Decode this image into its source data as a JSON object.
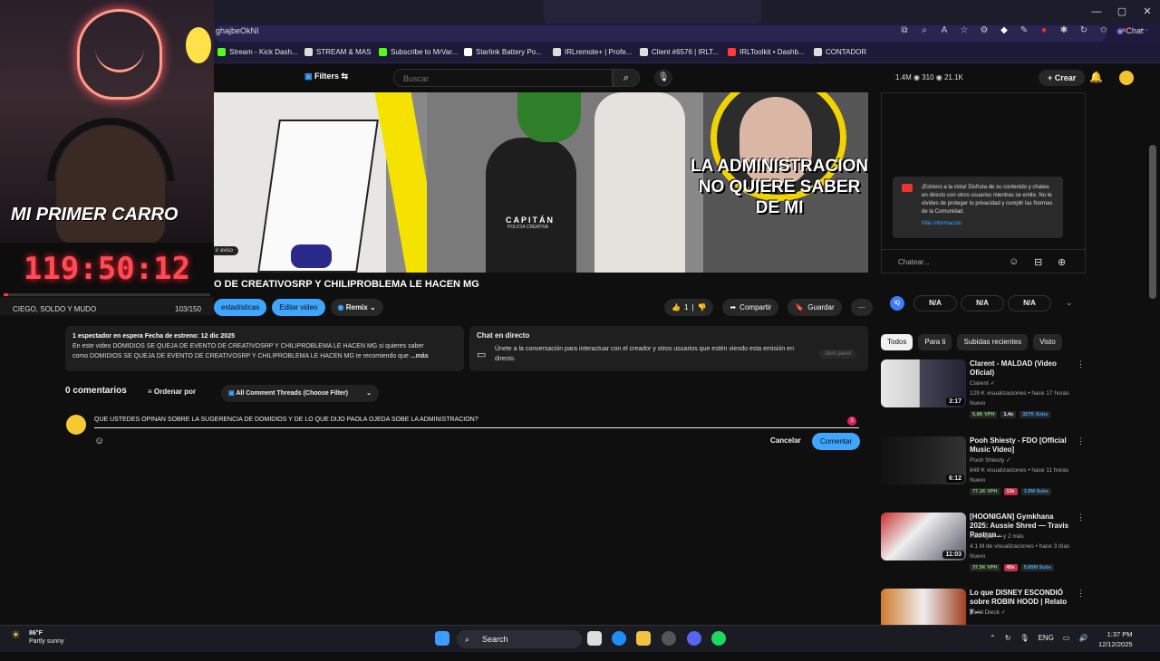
{
  "browser": {
    "url": "ghajbeOkNI",
    "chat_label": "Chat",
    "window_controls": [
      "—",
      "▢",
      "✕"
    ]
  },
  "bookmarks": [
    {
      "label": "Stream - Kick Dash...",
      "color": "#53fc18"
    },
    {
      "label": "STREAM & MAS",
      "color": "#dddddd"
    },
    {
      "label": "Subscribe to MrVar...",
      "color": "#53fc18"
    },
    {
      "label": "Starlink Battery Po...",
      "color": "#ffffff"
    },
    {
      "label": "IRLremote+ | Profe...",
      "color": "#dddddd"
    },
    {
      "label": "Client #6576 | IRLT...",
      "color": "#dddddd"
    },
    {
      "label": "IRLToolkit • Dashb...",
      "color": "#ff3b3b"
    },
    {
      "label": "CONTADOR",
      "color": "#dddddd"
    }
  ],
  "youtube": {
    "filters_label": "Filters",
    "search_placeholder": "Buscar",
    "stats": "1.4M  ◉ 310  ◉ 21.1K",
    "create_label": "Crear"
  },
  "webcam": {
    "overlay_text": "MI PRIMER CARRO",
    "timer": "119:50:12",
    "goal_label": "CIEGO, SOLDO Y MUDO",
    "goal_count": "103/150",
    "progress": 0.02
  },
  "video": {
    "overlay_title": "LA ADMINISTRACION NO QUIERE SABER DE MI",
    "capitan_text": "CAPITÁN",
    "policia_text": "POLICIA CREATIVA",
    "aviso_label": "ir aviso",
    "title": "O DE CREATIVOSRP Y CHILIPROBLEMA LE HACEN MG",
    "buttons": {
      "stats": "estadísticas",
      "edit": "Editar video",
      "remix": "Remix"
    },
    "actions": {
      "likes": "1",
      "share": "Compartir",
      "save": "Guardar"
    }
  },
  "description": {
    "meta": "1 espectador en espera  Fecha de estreno: 12 dic 2025",
    "line1": "En este video DOMIDIOS SE QUEJA DE EVENTO DE CREATIVOSRP Y CHILIPROBLEMA LE HACEN MG  si quieres saber",
    "line2": "como DOMIDIOS SE QUEJA DE EVENTO DE CREATIVOSRP Y CHILIPROBLEMA LE HACEN MG  te recomiendo que",
    "more": "...más"
  },
  "livechat_box": {
    "title": "Chat en directo",
    "text": "Únete a la conversación para interactuar con el creador y otros usuarios que estén viendo esta emisión en directo.",
    "button": "Abrir panel"
  },
  "comments": {
    "count_label": "0 comentarios",
    "sort_label": "Ordenar por",
    "filter_label": "All Comment Threads (Choose Filter)",
    "draft": "QUE USTEDES OPINAN SOBRE LA SUGERENCIA DE DOMIDIOS Y DE LO QUE DIJO PAOLA OJEDA SOBE LA ADMINISTRACION?",
    "badge": "3",
    "cancel": "Cancelar",
    "submit": "Comentar"
  },
  "chat_panel": {
    "notice": "¡Estreno a la vista! Disfruta de su contenido y chatea en directo con otros usuarios mientras se emite. No te olvides de proteger tu privacidad y cumplir las Normas de la Comunidad.",
    "more_info": "Más información",
    "input_placeholder": "Chatear..."
  },
  "iq_row": {
    "badge": "IQ",
    "values": [
      "N/A",
      "N/A",
      "N/A"
    ]
  },
  "chips": [
    "Todos",
    "Para ti",
    "Subidas recientes",
    "Visto"
  ],
  "recommendations": [
    {
      "title": "Clarent - MALDAD (Video Oficial)",
      "channel": "Clarent ✓",
      "meta": "129 K visualizaciones • hace 17 horas",
      "badge": "Nuevo",
      "duration": "3:17",
      "vph": "5.8K VPH",
      "mult": "1.4x",
      "subs": "327K Subs"
    },
    {
      "title": "Pooh Shiesty - FDO [Official Music Video]",
      "channel": "Pooh Shiesty ✓",
      "meta": "848 K visualizaciones • hace 11 horas",
      "badge": "Nuevo",
      "duration": "6:12",
      "vph": "77.1K VPH",
      "mult": "13x",
      "subs": "1.9M Subs"
    },
    {
      "title": "[HOONIGAN] Gymkhana 2025: Aussie Shred — Travis Pastran...",
      "channel": "Hoonigan ✓ y 2 más",
      "meta": "4.1 M de visualizaciones • hace 3 días",
      "badge": "Nuevo",
      "duration": "11:03",
      "vph": "37.5K VPH",
      "mult": "40x",
      "subs": "5.85M Subs"
    },
    {
      "title": "Lo que DISNEY ESCONDIÓ sobre ROBIN HOOD | Relato y ...",
      "channel": "Farid Dieck ✓",
      "meta": "",
      "badge": "",
      "duration": "",
      "vph": "",
      "mult": "",
      "subs": ""
    }
  ],
  "taskbar": {
    "temp": "86°F",
    "weather": "Partly sunny",
    "search": "Search",
    "lang": "ENG",
    "time": "1:37 PM",
    "date": "12/12/2025"
  }
}
